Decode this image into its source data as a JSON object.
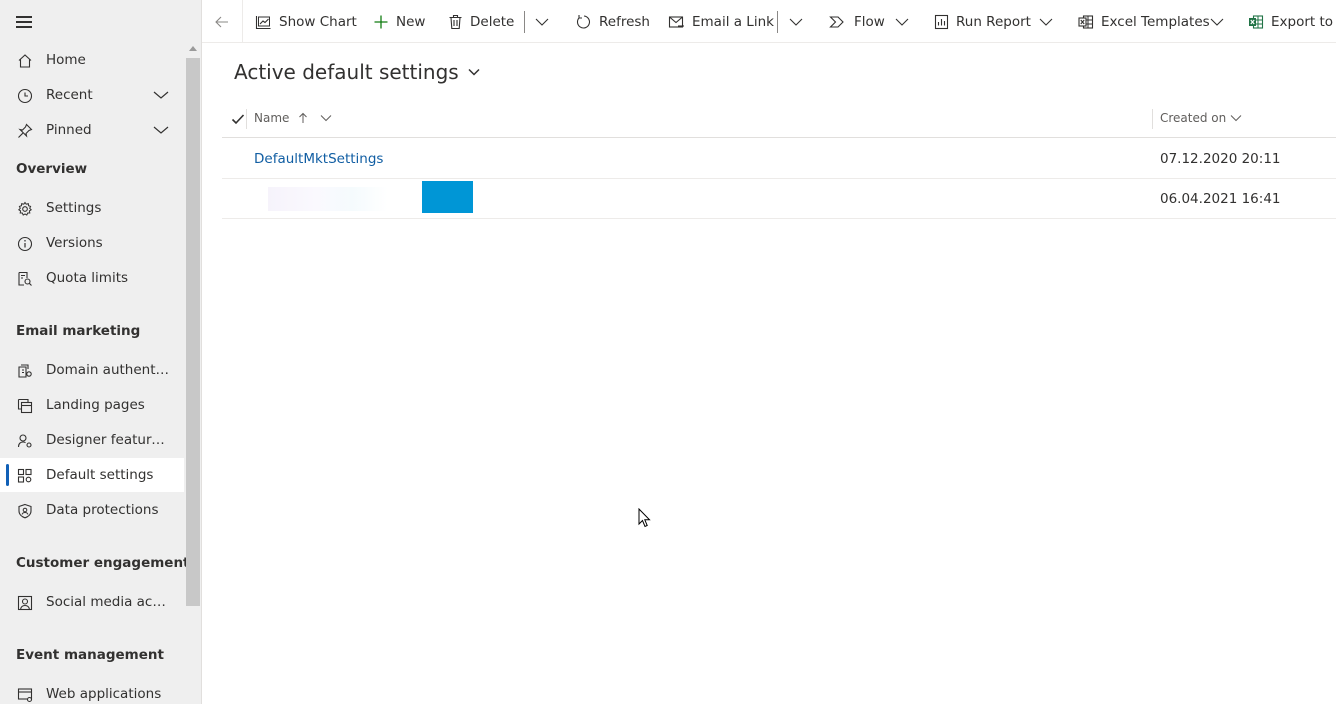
{
  "sidebar": {
    "top_items": [
      {
        "label": "Home",
        "icon": "home-icon"
      },
      {
        "label": "Recent",
        "icon": "clock-icon"
      },
      {
        "label": "Pinned",
        "icon": "pin-icon"
      }
    ],
    "sections": [
      {
        "title": "Overview",
        "items": [
          {
            "label": "Settings",
            "icon": "gear-icon"
          },
          {
            "label": "Versions",
            "icon": "info-icon"
          },
          {
            "label": "Quota limits",
            "icon": "quota-icon"
          }
        ]
      },
      {
        "title": "Email marketing",
        "items": [
          {
            "label": "Domain authentic...",
            "icon": "domain-icon"
          },
          {
            "label": "Landing pages",
            "icon": "pages-icon"
          },
          {
            "label": "Designer feature ...",
            "icon": "person-settings-icon"
          },
          {
            "label": "Default settings",
            "icon": "default-settings-icon"
          },
          {
            "label": "Data protections",
            "icon": "shield-icon"
          }
        ]
      },
      {
        "title": "Customer engagement",
        "items": [
          {
            "label": "Social media acco...",
            "icon": "social-icon"
          }
        ]
      },
      {
        "title": "Event management",
        "items": [
          {
            "label": "Web applications",
            "icon": "web-app-icon"
          }
        ]
      }
    ],
    "active_item": "Default settings"
  },
  "toolbar": {
    "show_chart": "Show Chart",
    "new": "New",
    "delete": "Delete",
    "refresh": "Refresh",
    "email_link": "Email a Link",
    "flow": "Flow",
    "run_report": "Run Report",
    "excel_templates": "Excel Templates",
    "export": "Export to E"
  },
  "view": {
    "title": "Active default settings"
  },
  "grid": {
    "columns": {
      "name": "Name",
      "created_on": "Created on"
    },
    "rows": [
      {
        "name": "DefaultMktSettings",
        "created_on": "07.12.2020 20:11"
      },
      {
        "name": "",
        "created_on": "06.04.2021 16:41"
      }
    ]
  },
  "colors": {
    "accent": "#1160b7",
    "link": "#115ea3",
    "redaction_blue": "#0096d6",
    "excel_green": "#217346"
  }
}
